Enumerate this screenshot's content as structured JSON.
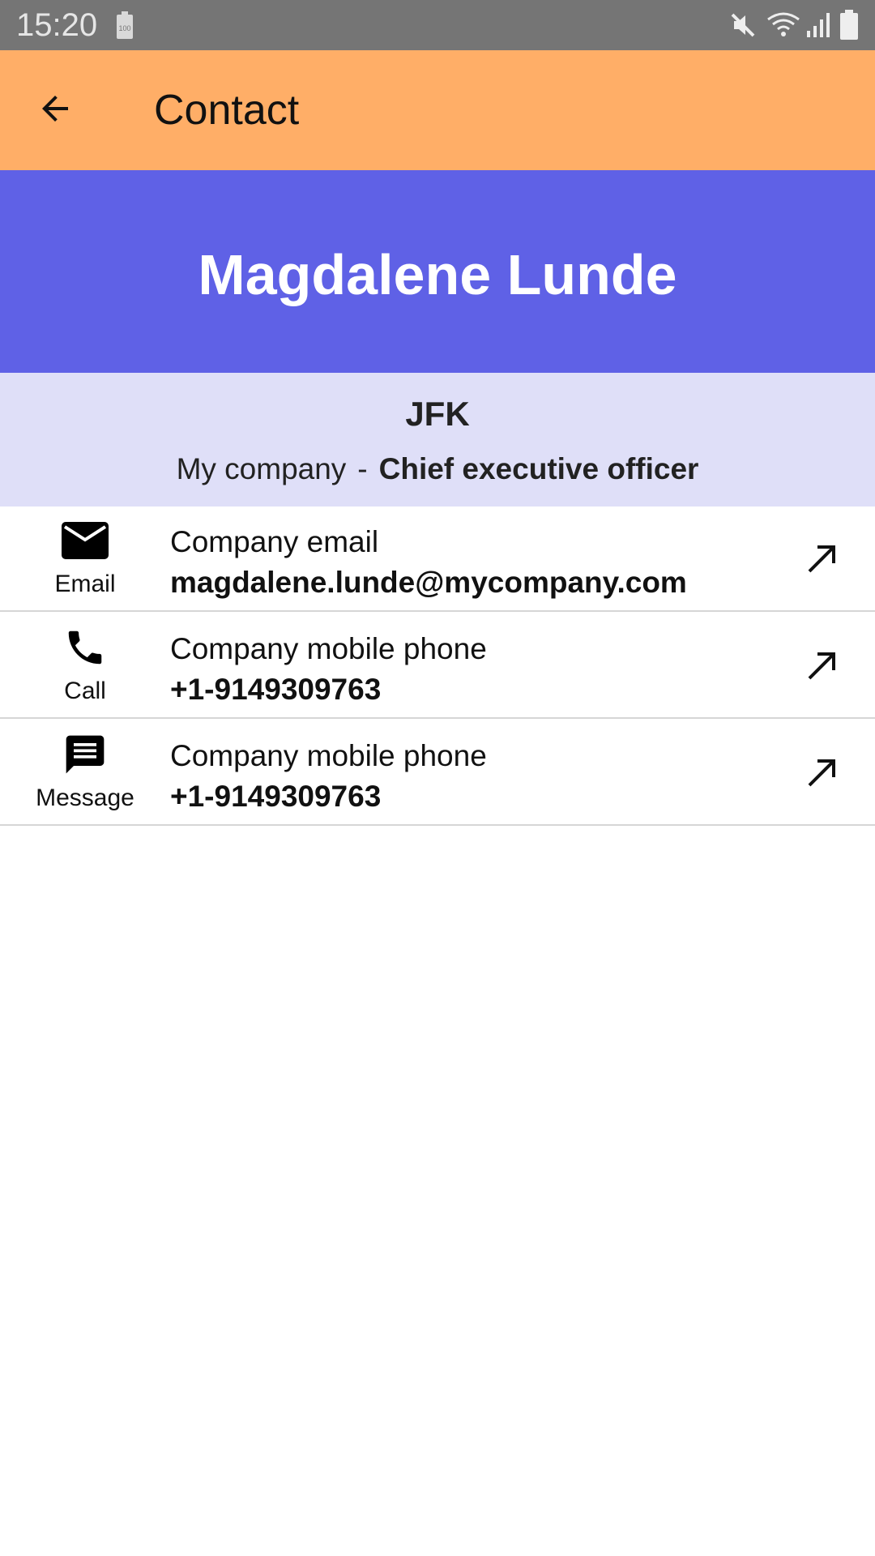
{
  "status_bar": {
    "time": "15:20",
    "icons": [
      "battery-saver-icon",
      "mute-icon",
      "wifi-icon",
      "signal-icon",
      "battery-icon"
    ]
  },
  "app_bar": {
    "title": "Contact",
    "back_icon": "arrow-back-icon"
  },
  "contact": {
    "name": "Magdalene Lunde",
    "initials": "JFK",
    "company": "My company",
    "separator": "-",
    "job_title": "Chief executive officer"
  },
  "actions": [
    {
      "icon": "email-icon",
      "label": "Email",
      "title": "Company email",
      "value": "magdalene.lunde@mycompany.com",
      "open_icon": "open-external-icon"
    },
    {
      "icon": "phone-icon",
      "label": "Call",
      "title": "Company mobile phone",
      "value": "+1-9149309763",
      "open_icon": "open-external-icon"
    },
    {
      "icon": "message-icon",
      "label": "Message",
      "title": "Company mobile phone",
      "value": "+1-9149309763",
      "open_icon": "open-external-icon"
    }
  ],
  "colors": {
    "status_bar": "#757575",
    "app_bar": "#ffae67",
    "name_banner": "#5f61e6",
    "info_band": "#dfdff8"
  }
}
